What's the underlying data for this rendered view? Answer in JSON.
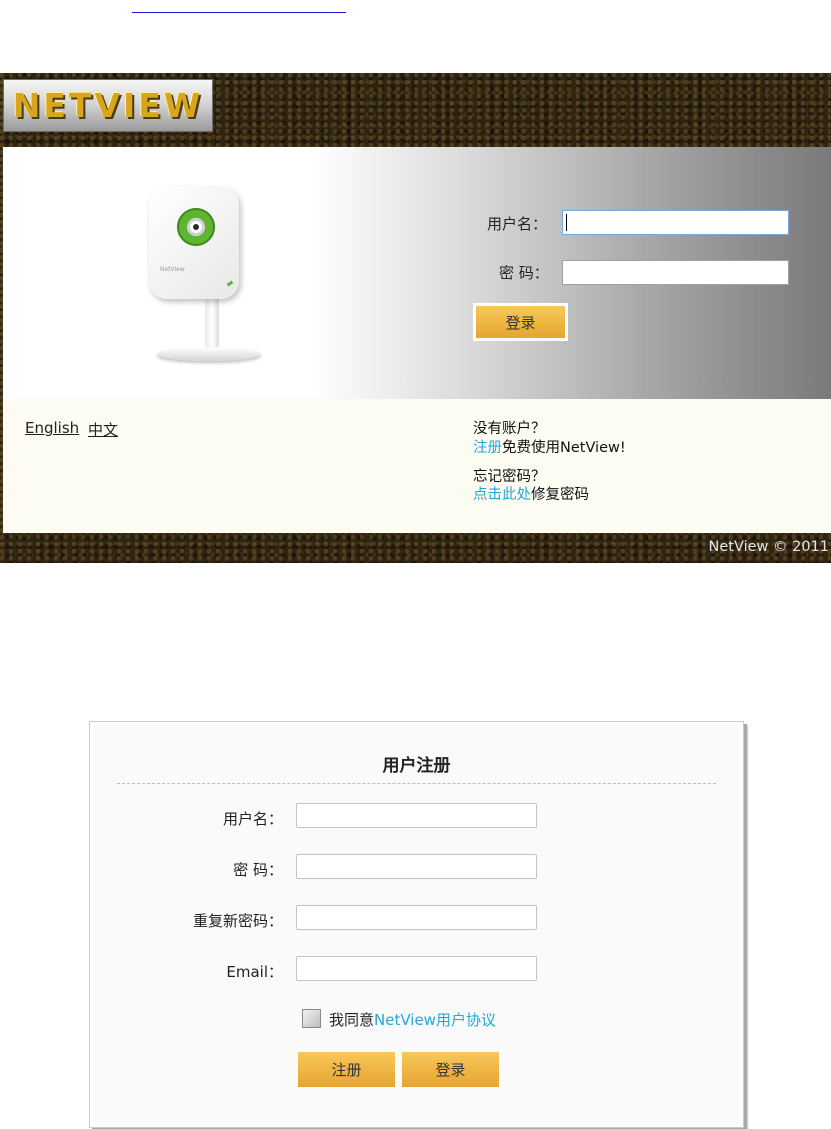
{
  "login": {
    "logo_text": "NETVIEW",
    "camera_brand": "NetView",
    "username_label": "用户名：",
    "password_label": "密 码：",
    "username_value": "",
    "password_value": "",
    "login_button": "登录",
    "lang_english": "English",
    "lang_chinese": "中文",
    "no_account": "没有账户？",
    "register_link": "注册",
    "register_suffix": "免费使用NetView!",
    "forgot_password": "忘记密码？",
    "click_here_link": "点击此处",
    "repair_suffix": "修复密码",
    "copyright": "NetView © 2011"
  },
  "register": {
    "title": "用户注册",
    "username_label": "用户名：",
    "password_label": "密 码：",
    "repeat_label": "重复新密码：",
    "email_label": "Email：",
    "agree_prefix": "我同意",
    "agreement_link": "NetView用户协议",
    "agreed": false,
    "register_button": "注册",
    "login_button": "登录"
  },
  "colors": {
    "link_cyan": "#24a7d6",
    "button_gold": "#e6a530",
    "frame_brown": "#2e2412"
  }
}
